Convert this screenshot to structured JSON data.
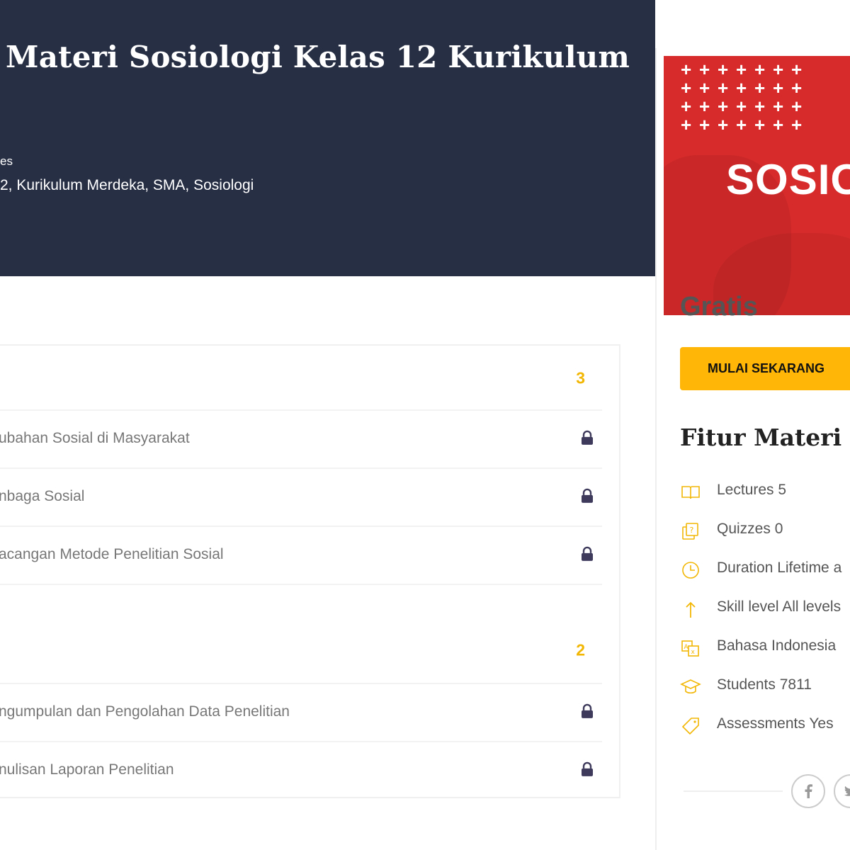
{
  "hero": {
    "title": "Materi Sosiologi Kelas 12 Kurikulum",
    "meta_line1": "es",
    "meta_line2": "2, Kurikulum Merdeka, SMA, Sosiologi"
  },
  "curriculum": {
    "sections": [
      {
        "count": "3",
        "lessons": [
          {
            "title": "ubahan Sosial di Masyarakat",
            "locked": true
          },
          {
            "title": "nbaga Sosial",
            "locked": true
          },
          {
            "title": "acangan Metode Penelitian Sosial",
            "locked": true
          }
        ]
      },
      {
        "count": "2",
        "lessons": [
          {
            "title": "ngumpulan dan Pengolahan Data Penelitian",
            "locked": true
          },
          {
            "title": "nulisan Laporan Penelitian",
            "locked": true
          }
        ]
      }
    ]
  },
  "sidebar": {
    "thumbnail_text": "SOSIO",
    "price": "Gratis",
    "cta_label": "MULAI SEKARANG",
    "features_title": "Fitur Materi",
    "features": [
      {
        "icon": "book-icon",
        "text": "Lectures 5"
      },
      {
        "icon": "quiz-icon",
        "text": "Quizzes 0"
      },
      {
        "icon": "clock-icon",
        "text": "Duration Lifetime a"
      },
      {
        "icon": "level-arrow-icon",
        "text": "Skill level All levels"
      },
      {
        "icon": "language-icon",
        "text": "Bahasa Indonesia"
      },
      {
        "icon": "graduation-cap-icon",
        "text": "Students 7811"
      },
      {
        "icon": "tag-icon",
        "text": "Assessments Yes"
      }
    ],
    "social": [
      {
        "icon": "facebook-icon"
      },
      {
        "icon": "twitter-icon"
      }
    ]
  },
  "colors": {
    "hero_bg": "#272f45",
    "accent": "#ffb606",
    "count": "#f2b705",
    "thumbnail_red": "#d72b2b",
    "lock": "#3d3a5c"
  }
}
